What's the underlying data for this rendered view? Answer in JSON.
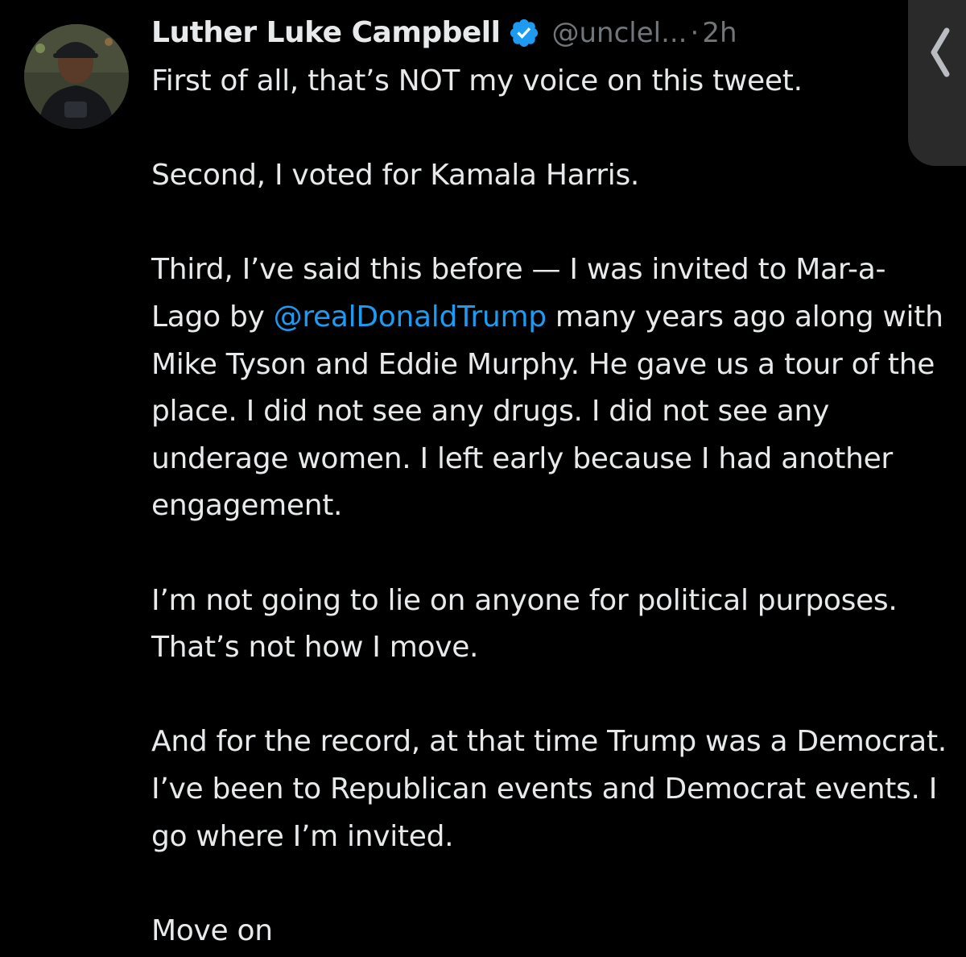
{
  "tweet": {
    "display_name": "Luther Luke Campbell",
    "handle": "@unclel...",
    "separator": "·",
    "time": "2h",
    "paragraphs": [
      "First of all, that’s NOT my voice on this tweet.",
      "Second, I voted for Kamala Harris.",
      {
        "before": "Third, I’ve said this before — I was invited to Mar-a-Lago by ",
        "mention": "@realDonaldTrump",
        "after": " many years ago along with Mike Tyson and Eddie Murphy. He gave us a tour of the place. I did not see any drugs. I did not see any underage women. I left early because I had another engagement."
      },
      "I’m not going to lie on anyone for political purposes. That’s not how I move.",
      "And for the record, at that time Trump was a Democrat. I’ve been to Republican events and Democrat events. I go where I’m invited.",
      "Move on"
    ]
  },
  "icons": {
    "verified": "verified-badge-icon",
    "more": "more-options-icon",
    "side_handle": "chevron-left-icon"
  },
  "colors": {
    "background": "#000000",
    "text": "#e7e9ea",
    "secondary_text": "#71767b",
    "mention": "#1d9bf0",
    "verified": "#1d9bf0"
  }
}
